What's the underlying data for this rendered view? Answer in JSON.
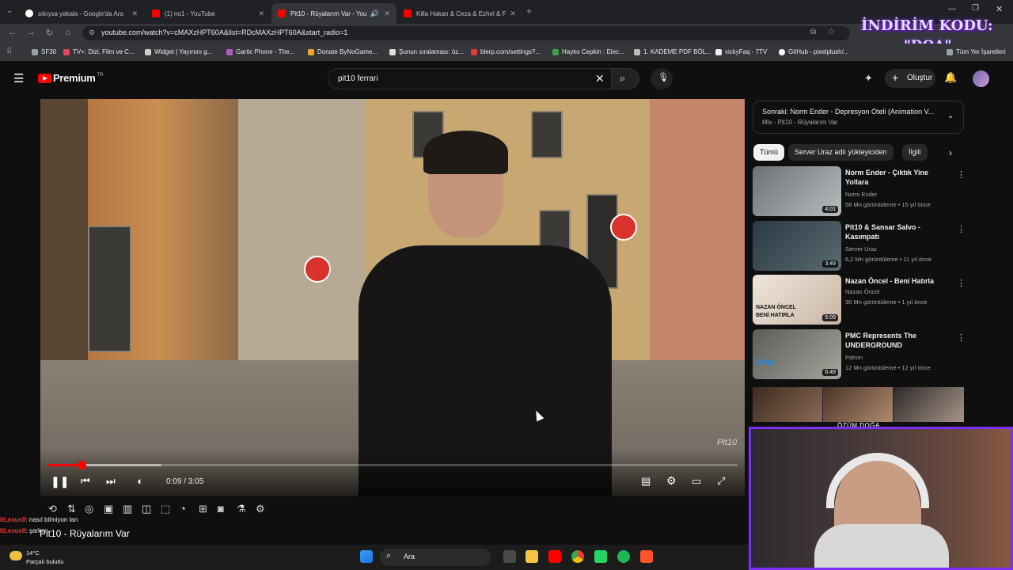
{
  "browser": {
    "tabs": [
      {
        "title": "sıkıysa yakala - Google'da Ara",
        "color": "#4285f4"
      },
      {
        "title": "(1) no1 - YouTube",
        "color": "#ff0000"
      },
      {
        "title": "Pit10 - Rüyalarım Var - You",
        "color": "#ff0000"
      },
      {
        "title": "Killa Hakan & Ceza & Ezhel & F",
        "color": "#ff0000"
      }
    ],
    "url": "youtube.com/watch?v=cMAXzHPT60A&list=RDcMAXzHPT60A&start_radio=1",
    "bookmarks": [
      "SF30",
      "TV+: Dizi, Film ve C...",
      "Widget | Yayınını g...",
      "Gartic Phone - The...",
      "Donate ByNoGame...",
      "Şunun sıralaması: öz...",
      "blerp.com/settings?...",
      "Hayko Cepkin : Elec...",
      "1. KADEME PDF BÖL...",
      "vickyFaq - 7TV",
      "GitHub - pixelplush/..."
    ],
    "bookmarks_all": "Tüm Yer İşaretleri"
  },
  "overlay": {
    "promo_line1": "İNDİRİM KODU:",
    "promo_line2": "\"DOA\""
  },
  "youtube": {
    "logo": "Premium",
    "region": "TR",
    "search_value": "pit10 ferrari",
    "create_label": "Oluştur"
  },
  "player": {
    "time": "0:09 / 3:05",
    "progress": 0.049,
    "buffer": 0.165,
    "watermark": "Pit10"
  },
  "upnext": {
    "title": "Sonraki: Norm Ender - Depresyon Oteli (Animation V...",
    "subtitle": "Mix - Pit10 - Rüyalarım Var"
  },
  "chips": [
    "Tümü",
    "Server Uraz adlı yükleyiciden",
    "İlgili"
  ],
  "videos": [
    {
      "title": "Norm Ender - Çıktık Yine Yollara",
      "channel": "Norm Ender",
      "meta": "58 Mn görüntüleme • 15 yıl önce",
      "duration": "4:01",
      "thumb": "#8a8f92"
    },
    {
      "title": "Pit10 & Sansar Salvo - Kasımpatı",
      "channel": "Server Uraz",
      "meta": "6,2 Mn görüntüleme • 11 yıl önce",
      "duration": "3:49",
      "thumb": "#3a4a52"
    },
    {
      "title": "Nazan Öncel - Beni Hatırla",
      "channel": "Nazan Öncel",
      "meta": "30 Mn görüntüleme • 1 yıl önce",
      "duration": "5:09",
      "thumb": "#d9cfc4"
    },
    {
      "title": "PMC Represents The UNDERGROUND",
      "channel": "Patron",
      "meta": "12 Mn görüntüleme • 12 yıl önce",
      "duration": "6:49",
      "thumb": "#7d7d78"
    }
  ],
  "nazan_thumb_text": [
    "NAZAN ÖNCEL",
    "BENİ HATIRLA"
  ],
  "pmc_thumb_text": "PMC",
  "cam": {
    "label": "ÖZÜM DOĞA"
  },
  "chat": [
    {
      "user": "ItLexusII",
      "text": ": nasıl bilmiyon lan"
    },
    {
      "user": "ItLexusII",
      "text": ": şarkıyı"
    }
  ],
  "song_title": "Pit10 - Rüyalarım Var",
  "weather": {
    "temp": "14°C",
    "desc": "Parçalı bulutlu"
  },
  "taskbar": {
    "search": "Ara"
  }
}
